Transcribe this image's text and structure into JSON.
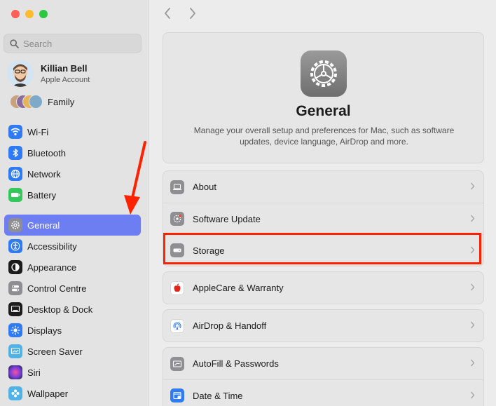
{
  "search": {
    "placeholder": "Search"
  },
  "account": {
    "name": "Killian Bell",
    "subtitle": "Apple Account"
  },
  "family": {
    "label": "Family"
  },
  "sidebar": {
    "items": [
      {
        "label": "Wi-Fi",
        "icon": "wifi-icon",
        "color": "#2f7bf5"
      },
      {
        "label": "Bluetooth",
        "icon": "bluetooth-icon",
        "color": "#2f7bf5"
      },
      {
        "label": "Network",
        "icon": "globe-icon",
        "color": "#2f7bf5"
      },
      {
        "label": "Battery",
        "icon": "battery-icon",
        "color": "#34c759"
      },
      {
        "label": "General",
        "icon": "gear-icon",
        "color": "#8e8e93"
      },
      {
        "label": "Accessibility",
        "icon": "accessibility-icon",
        "color": "#2f7bf5"
      },
      {
        "label": "Appearance",
        "icon": "appearance-icon",
        "color": "#1c1c1c"
      },
      {
        "label": "Control Centre",
        "icon": "toggles-icon",
        "color": "#8e8e93"
      },
      {
        "label": "Desktop & Dock",
        "icon": "dock-icon",
        "color": "#1c1c1c"
      },
      {
        "label": "Displays",
        "icon": "sun-icon",
        "color": "#2f7bf5"
      },
      {
        "label": "Screen Saver",
        "icon": "screensaver-icon",
        "color": "#4fb3e8"
      },
      {
        "label": "Siri",
        "icon": "siri-icon",
        "color": "#5b3fa8"
      },
      {
        "label": "Wallpaper",
        "icon": "flower-icon",
        "color": "#4fb3e8"
      }
    ]
  },
  "main": {
    "title": "General",
    "description": "Manage your overall setup and preferences for Mac, such as software updates, device language, AirDrop and more.",
    "rows": [
      {
        "label": "About",
        "icon": "laptop-icon"
      },
      {
        "label": "Software Update",
        "icon": "software-update-icon"
      },
      {
        "label": "Storage",
        "icon": "drive-icon"
      },
      {
        "label": "AppleCare & Warranty",
        "icon": "apple-icon"
      },
      {
        "label": "AirDrop & Handoff",
        "icon": "airdrop-icon"
      },
      {
        "label": "AutoFill & Passwords",
        "icon": "autofill-icon"
      },
      {
        "label": "Date & Time",
        "icon": "calendar-icon"
      }
    ]
  },
  "colors": {
    "accent": "#6d7ef2",
    "highlight": "#ff2200"
  }
}
